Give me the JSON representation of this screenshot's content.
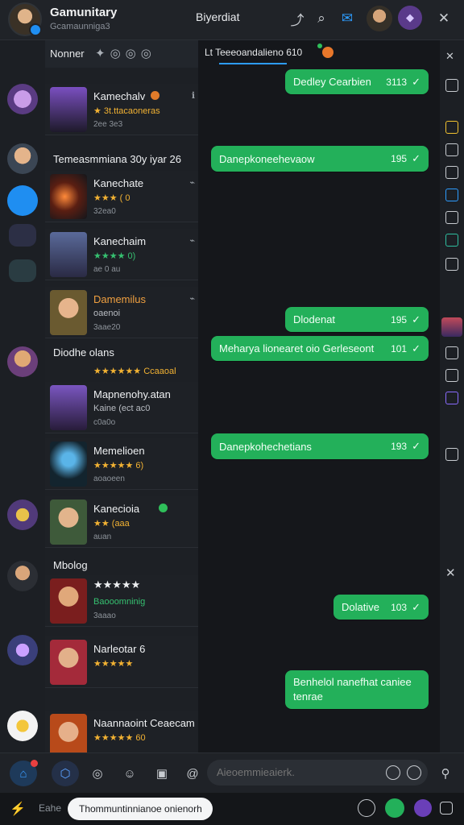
{
  "header": {
    "title": "Gamunitary",
    "subtitle": "Gcamaunniga3",
    "center_title": "Biyerdiat"
  },
  "list": {
    "head_label": "Nonner",
    "cards_a": [
      {
        "name": "Kamechalv",
        "stars": "★ 3t.ttacaoneras",
        "meta": "2ee 3e3",
        "icon": "ℹ"
      },
      {
        "name": "Kanechate",
        "stars": "★★★ ( 0",
        "meta": "32ea0",
        "icon": "⌁"
      },
      {
        "name": "Kanechaim",
        "stars": "★★★★ 0)",
        "meta": "ae 0 au",
        "icon": "⌁"
      },
      {
        "name": "Damemilus",
        "stars": "oaenoi",
        "meta": "3aae20",
        "icon": "⌁"
      }
    ],
    "section_one": "Temeasmmiana 30y iyar 26",
    "section_two": "Diodhe olans",
    "section_two_stars": "★★★★★★ Ccaaoal",
    "cards_b": [
      {
        "name": "Mapnenohy.atan",
        "stars": "Kaine (ect ac0",
        "meta": "c0a0o",
        "icon": ""
      },
      {
        "name": "Memelioen",
        "stars": "★★★★★ 6)",
        "meta": "aoaoeen",
        "icon": ""
      },
      {
        "name": "Kanecioia",
        "stars": "★★ (aaa",
        "meta": "auan",
        "icon": ""
      }
    ],
    "section_three": "Mbolog",
    "cards_c": [
      {
        "name": "",
        "stars": "★★★★★",
        "meta": "3aaao",
        "sub": "Baooomninig"
      },
      {
        "name": "Narleotar 6",
        "stars": "★★★★★",
        "meta": "",
        "sub": ""
      },
      {
        "name": "Naannaoint Ceaecam",
        "stars": "★★★★★ 60",
        "meta": "",
        "sub": ""
      }
    ]
  },
  "chat": {
    "tab_label": "Lt Teeeoandalieno 610",
    "messages": [
      {
        "text": "Dedley Cearbien",
        "time": "3113"
      },
      {
        "text": "Danepkoneehevaow",
        "time": "195"
      },
      {
        "text": "Dlodenat",
        "time": "195"
      },
      {
        "text": "Meharya lionearet oio Gerleseont",
        "time": "101"
      },
      {
        "text": "Danepkohechetians",
        "time": "193"
      },
      {
        "text": "Dolative",
        "time": "103"
      },
      {
        "text": "Benhelol nanefhat caniee tenrae",
        "time": ""
      }
    ]
  },
  "composer": {
    "placeholder": "Aieoemmieaierk."
  },
  "footer": {
    "label": "Eahe",
    "search_value": "Thommuntinnianoe onienorh"
  },
  "colors": {
    "bubble": "#23b05a",
    "accent": "#2d9cff",
    "star": "#f2b233"
  }
}
